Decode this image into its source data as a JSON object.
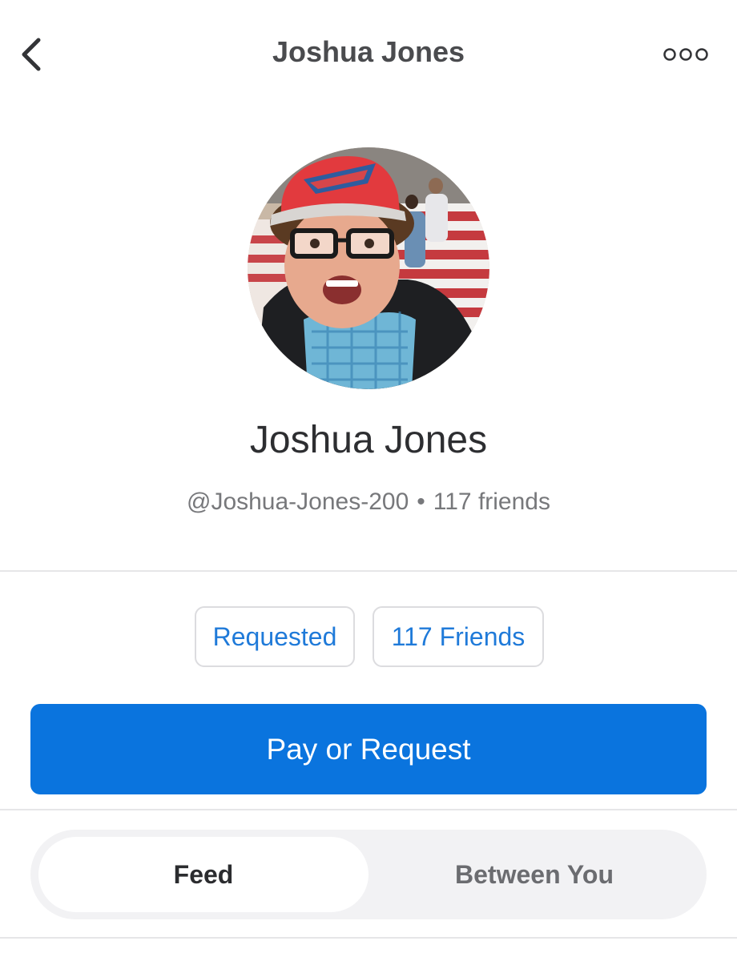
{
  "header": {
    "title": "Joshua Jones",
    "back_icon": "chevron-left-icon",
    "more_icon": "more-horizontal-icon"
  },
  "profile": {
    "name": "Joshua Jones",
    "username": "@Joshua-Jones-200",
    "separator": "•",
    "friends_count_text": "117 friends"
  },
  "actions": {
    "requested_label": "Requested",
    "friends_label": "117 Friends",
    "pay_label": "Pay or Request"
  },
  "tabs": [
    {
      "label": "Feed",
      "active": true
    },
    {
      "label": "Between You",
      "active": false
    }
  ],
  "colors": {
    "accent": "#0a74de",
    "link": "#1f7ad9",
    "secondary_text": "#77787b",
    "divider": "#e6e6e8"
  }
}
